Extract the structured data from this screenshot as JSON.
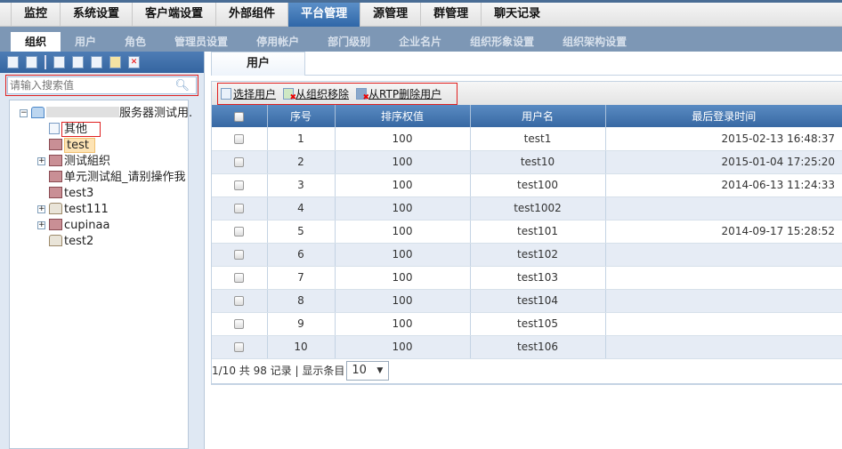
{
  "topnav": {
    "items": [
      "监控",
      "系统设置",
      "客户端设置",
      "外部组件",
      "平台管理",
      "源管理",
      "群管理",
      "聊天记录"
    ],
    "active": 4
  },
  "subnav": {
    "items": [
      "组织",
      "用户",
      "角色",
      "管理员设置",
      "停用帐户",
      "部门级别",
      "企业名片",
      "组织形象设置",
      "组织架构设置"
    ],
    "active": 0
  },
  "left": {
    "search_placeholder": "请输入搜索值",
    "tree": [
      {
        "label": "服务器测试用.",
        "icon": "home-icon",
        "toggle": "−",
        "level": 0
      },
      {
        "label": "其他",
        "icon": "document-icon",
        "level": 1,
        "highlighted": true
      },
      {
        "label": "test",
        "icon": "group-icon",
        "level": 1,
        "selected": true
      },
      {
        "label": "测试組织",
        "icon": "group-icon",
        "toggle": "+",
        "level": 1
      },
      {
        "label": "单元测试組_请别操作我",
        "icon": "group-icon",
        "level": 1
      },
      {
        "label": "test3",
        "icon": "group-icon",
        "level": 1
      },
      {
        "label": "test111",
        "icon": "home-icon",
        "toggle": "+",
        "level": 1
      },
      {
        "label": "cupinaa",
        "icon": "group-icon",
        "toggle": "+",
        "level": 1
      },
      {
        "label": "test2",
        "icon": "home-icon",
        "level": 1
      }
    ]
  },
  "right": {
    "tab": "用户",
    "toolbar": {
      "select_user": "选择用户",
      "remove_from_org": "从组织移除",
      "delete_from_rtp": "从RTP删除用户"
    },
    "columns": [
      "序号",
      "排序权值",
      "用户名",
      "最后登录时间"
    ],
    "rows": [
      [
        "1",
        "100",
        "test1",
        "2015-02-13 16:48:37"
      ],
      [
        "2",
        "100",
        "test10",
        "2015-01-04 17:25:20"
      ],
      [
        "3",
        "100",
        "test100",
        "2014-06-13 11:24:33"
      ],
      [
        "4",
        "100",
        "test1002",
        ""
      ],
      [
        "5",
        "100",
        "test101",
        "2014-09-17 15:28:52"
      ],
      [
        "6",
        "100",
        "test102",
        ""
      ],
      [
        "7",
        "100",
        "test103",
        ""
      ],
      [
        "8",
        "100",
        "test104",
        ""
      ],
      [
        "9",
        "100",
        "test105",
        ""
      ],
      [
        "10",
        "100",
        "test106",
        ""
      ]
    ],
    "pager": {
      "text": "1/10 共 98 记录 | 显示条目",
      "page_size": "10"
    }
  }
}
